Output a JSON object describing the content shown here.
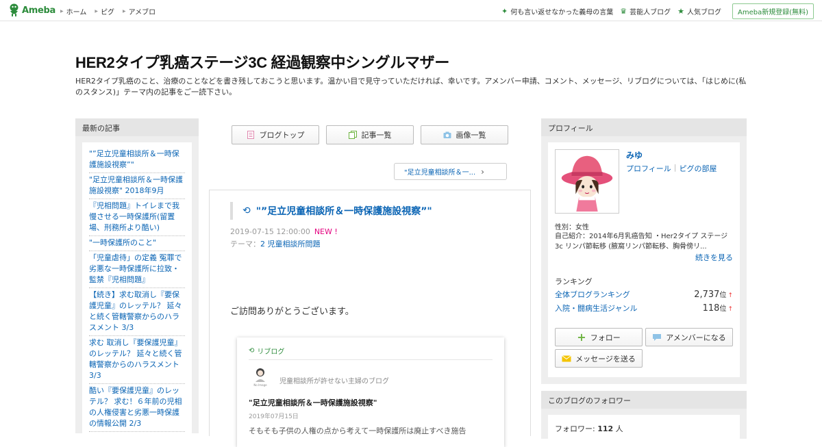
{
  "header": {
    "logo_text": "Ameba",
    "nav": [
      {
        "label": "ホーム"
      },
      {
        "label": "ピグ"
      },
      {
        "label": "アメブロ"
      }
    ],
    "right_links": [
      {
        "icon": "sparkle-icon",
        "label": "何も言い返せなかった義母の言葉"
      },
      {
        "icon": "crown-icon",
        "label": "芸能人ブログ"
      },
      {
        "icon": "star-icon",
        "label": "人気ブログ"
      }
    ],
    "signup_label": "Ameba新規登録(無料)"
  },
  "blog": {
    "title": "HER2タイプ乳癌ステージ3C 経過観察中シングルマザー",
    "description": "HER2タイプ乳癌のこと、治療のことなどを書き残しておこうと思います。温かい目で見守っていただければ、幸いです。アメンバー申請、コメント、メッセージ、リブログについては、「はじめに(私のスタンス)」テーマ内の記事をご一読下さい。"
  },
  "left_sidebar": {
    "heading": "最新の記事",
    "items": [
      "\"”足立児童相談所＆一時保護施設視察”\"",
      "\"足立児童相談所＆一時保護施設視察\" 2018年9月",
      "『児相問題』トイレまで我慢させる一時保護所(留置場、刑務所より酷い)",
      "\"一時保護所のこと\"",
      "「児童虐待」の定義 冤罪で劣悪な一時保護所に拉致・監禁『児相問題』",
      "【続き】求む取消し『要保護児童』のレッテル？ 延々と続く管轄警察からのハラスメント 3/3",
      "求む 取消し『要保護児童』のレッテル？ 延々と続く管轄警察からのハラスメント 3/3",
      "酷い『要保護児童』のレッテル？ 求む！６年前の児相の人権侵害と劣悪一時保護の情報公開 2/3"
    ]
  },
  "tabs": [
    {
      "label": "ブログトップ",
      "icon": "document-icon"
    },
    {
      "label": "記事一覧",
      "icon": "pages-icon"
    },
    {
      "label": "画像一覧",
      "icon": "camera-icon"
    }
  ],
  "next_link": "\"足立児童相談所＆一...",
  "entry": {
    "title": "\"”足立児童相談所＆一時保護施設視察”\"",
    "datetime": "2019-07-15 12:00:00",
    "new_badge": "NEW !",
    "theme_prefix": "テーマ：",
    "theme": "2 児童相談所問題",
    "greeting": "ご訪問ありがとうございます。"
  },
  "reblog_card": {
    "label": "リブログ",
    "blog_name": "児童相談所が許せない主婦のブログ",
    "avatar_caption": "No Image",
    "title": "\"足立児童相談所＆一時保護施設視察\"",
    "date": "2019年07月15日",
    "excerpt": "そもそも子供の人権の点から考えて一時保護所は廃止すべき施告"
  },
  "profile": {
    "heading": "プロフィール",
    "name": "みゆ",
    "link_profile": "プロフィール",
    "link_pigg": "ピグの部屋",
    "gender": "性別：女性",
    "intro": "自己紹介：2014年6月乳癌告知 ・Her2タイプ ステージ3c リンパ節転移 (腋窩リンパ節転移、胸骨傍リ...",
    "more": "続きを見る",
    "ranking_heading": "ランキング",
    "rankings": [
      {
        "label": "全体ブログランキング",
        "value": "2,737",
        "unit": "位",
        "arrow": "↑"
      },
      {
        "label": "入院・闘病生活ジャンル",
        "value": "118",
        "unit": "位",
        "arrow": "↑"
      }
    ],
    "buttons": {
      "follow": "フォロー",
      "amember": "アメンバーになる",
      "message": "メッセージを送る"
    }
  },
  "followers": {
    "heading": "このブログのフォロワー",
    "prefix": "フォロワー: ",
    "count": "112",
    "suffix": " 人"
  },
  "colors": {
    "brand_green": "#2d8c3c",
    "link_blue": "#0a64b4",
    "new_pink": "#e3007f"
  }
}
